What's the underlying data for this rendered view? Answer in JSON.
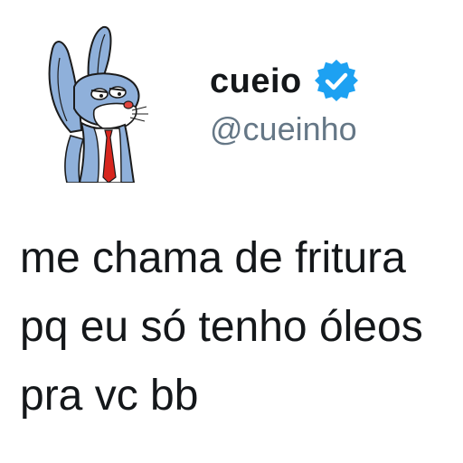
{
  "user": {
    "display_name": "cueio",
    "handle": "@cueinho",
    "verified": true,
    "avatar_icon": "bugs-bunny-avatar-icon",
    "verified_icon": "verified-badge-icon",
    "verified_color": "#1da1f2"
  },
  "tweet": {
    "lines": [
      "me chama de fritura",
      "pq eu só tenho óleos",
      "pra vc bb"
    ]
  }
}
